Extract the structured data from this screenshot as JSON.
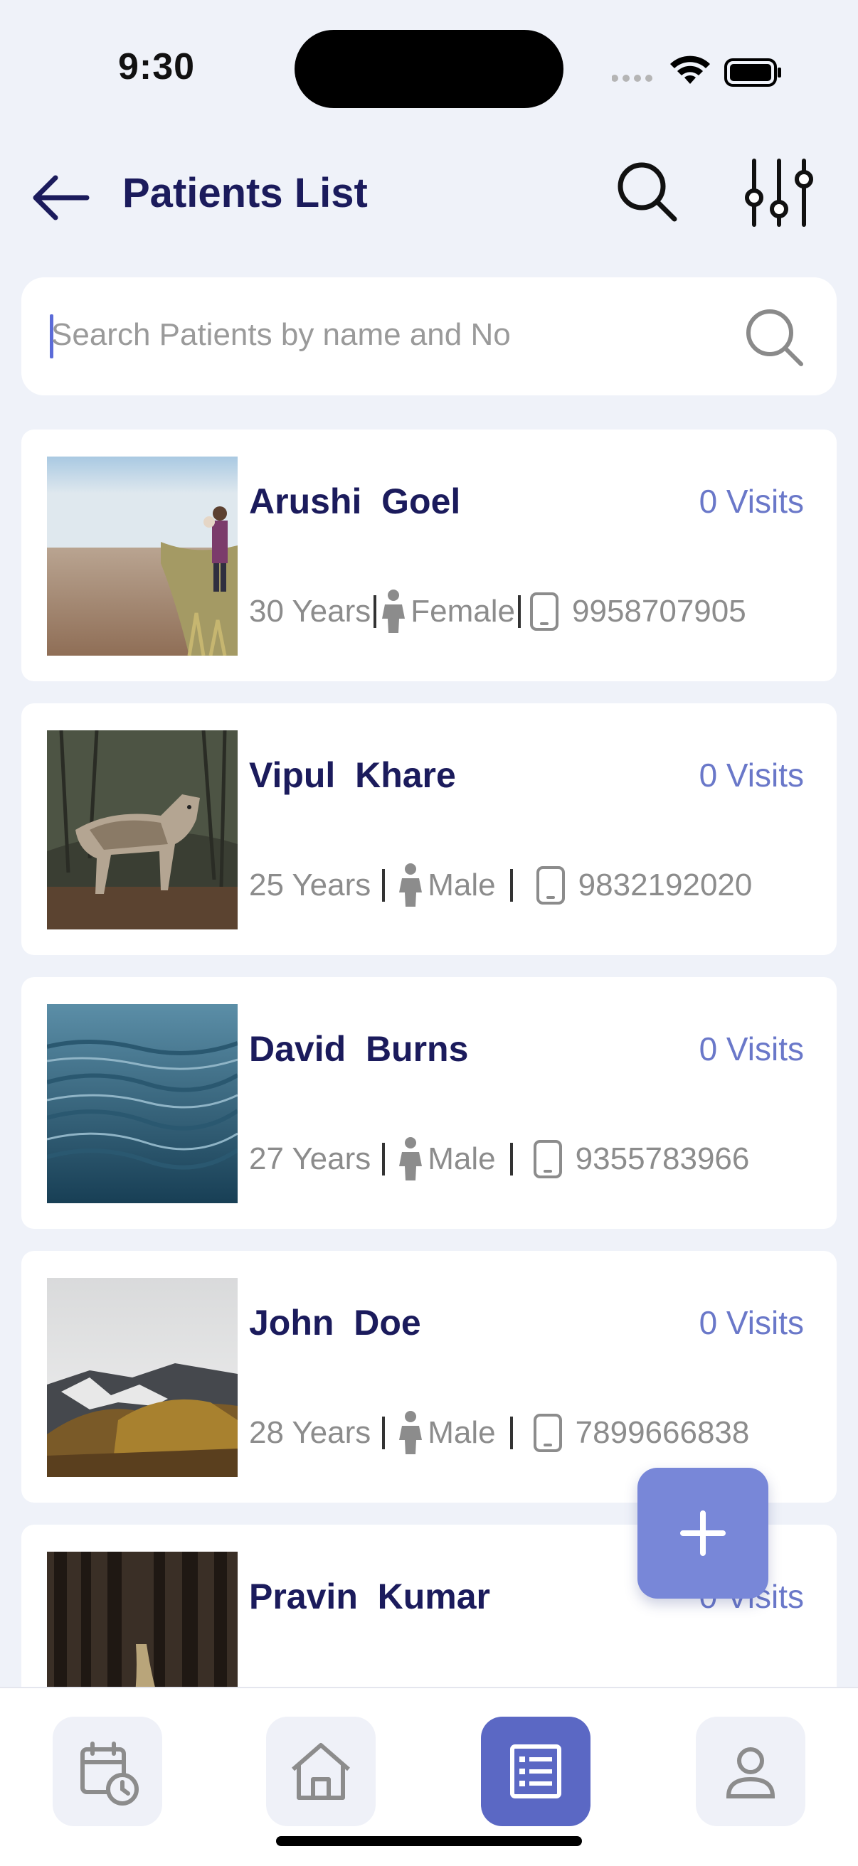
{
  "status_bar": {
    "time": "9:30"
  },
  "header": {
    "title": "Patients List"
  },
  "search": {
    "placeholder": "Search Patients by name and No"
  },
  "patients": [
    {
      "name": "Arushi  Goel",
      "visits": "0 Visits",
      "age": "30 Years",
      "gender": "Female",
      "phone": "9958707905"
    },
    {
      "name": "Vipul  Khare",
      "visits": "0 Visits",
      "age": "25 Years",
      "gender": "Male",
      "phone": "9832192020"
    },
    {
      "name": "David  Burns",
      "visits": "0 Visits",
      "age": "27 Years",
      "gender": "Male",
      "phone": "9355783966"
    },
    {
      "name": "John  Doe",
      "visits": "0 Visits",
      "age": "28 Years",
      "gender": "Male",
      "phone": "7899666838"
    },
    {
      "name": "Pravin  Kumar",
      "visits": "0 Visits"
    }
  ],
  "bottom_nav": {
    "items": [
      {
        "icon": "calendar-clock-icon",
        "active": false
      },
      {
        "icon": "home-icon",
        "active": false
      },
      {
        "icon": "list-icon",
        "active": true
      },
      {
        "icon": "profile-icon",
        "active": false
      }
    ]
  },
  "colors": {
    "accent": "#5b68c4",
    "fab": "#7887d8",
    "title": "#1b1b5c",
    "visits": "#6a78c9",
    "background": "#eff2f9"
  }
}
